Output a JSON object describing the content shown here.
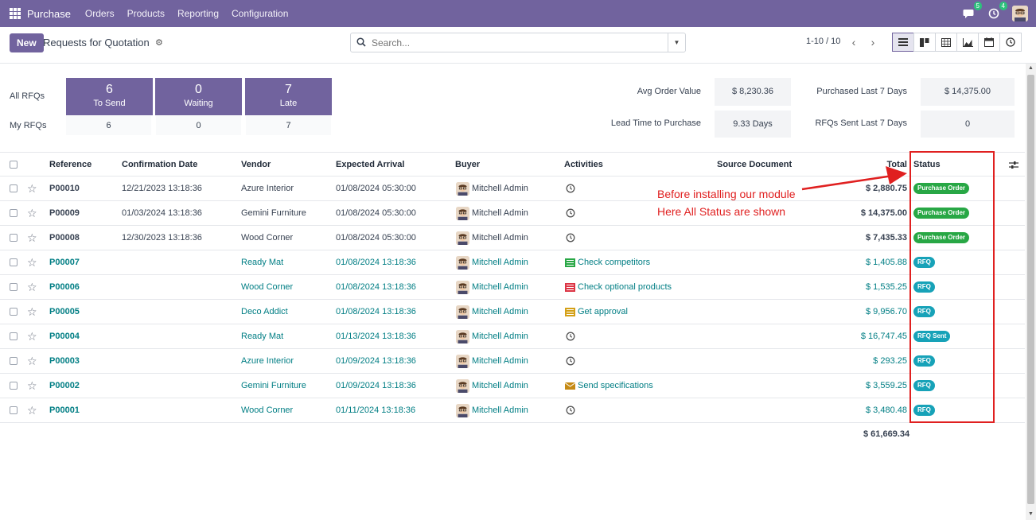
{
  "nav": {
    "brand": "Purchase",
    "menu": [
      "Orders",
      "Products",
      "Reporting",
      "Configuration"
    ],
    "messages_count": "5",
    "activities_count": "4"
  },
  "control": {
    "new_label": "New",
    "title": "Requests for Quotation",
    "search_placeholder": "Search...",
    "pager": "1-10 / 10"
  },
  "dashboard": {
    "all_rfqs_label": "All RFQs",
    "my_rfqs_label": "My RFQs",
    "tiles": [
      {
        "value": "6",
        "label": "To Send",
        "mine": "6"
      },
      {
        "value": "0",
        "label": "Waiting",
        "mine": "0"
      },
      {
        "value": "7",
        "label": "Late",
        "mine": "7"
      }
    ],
    "stats": [
      {
        "label": "Avg Order Value",
        "value": "$ 8,230.36"
      },
      {
        "label": "Purchased Last 7 Days",
        "value": "$ 14,375.00"
      },
      {
        "label": "Lead Time to Purchase",
        "value": "9.33 Days"
      },
      {
        "label": "RFQs Sent Last 7 Days",
        "value": "0"
      }
    ]
  },
  "table": {
    "columns": [
      "Reference",
      "Confirmation Date",
      "Vendor",
      "Expected Arrival",
      "Buyer",
      "Activities",
      "Source Document",
      "Total",
      "Status"
    ],
    "rows": [
      {
        "ref": "P00010",
        "conf": "12/21/2023 13:18:36",
        "vendor": "Azure Interior",
        "arrival": "01/08/2024 05:30:00",
        "buyer": "Mitchell Admin",
        "activity": "",
        "act_icon": "clock",
        "total": "$ 2,880.75",
        "status": "Purchase Order",
        "kind": "po"
      },
      {
        "ref": "P00009",
        "conf": "01/03/2024 13:18:36",
        "vendor": "Gemini Furniture",
        "arrival": "01/08/2024 05:30:00",
        "buyer": "Mitchell Admin",
        "activity": "",
        "act_icon": "clock",
        "total": "$ 14,375.00",
        "status": "Purchase Order",
        "kind": "po"
      },
      {
        "ref": "P00008",
        "conf": "12/30/2023 13:18:36",
        "vendor": "Wood Corner",
        "arrival": "01/08/2024 05:30:00",
        "buyer": "Mitchell Admin",
        "activity": "",
        "act_icon": "clock",
        "total": "$ 7,435.33",
        "status": "Purchase Order",
        "kind": "po"
      },
      {
        "ref": "P00007",
        "conf": "",
        "vendor": "Ready Mat",
        "arrival": "01/08/2024 13:18:36",
        "buyer": "Mitchell Admin",
        "activity": "Check competitors",
        "act_icon": "list-green",
        "total": "$ 1,405.88",
        "status": "RFQ",
        "kind": "rfq"
      },
      {
        "ref": "P00006",
        "conf": "",
        "vendor": "Wood Corner",
        "arrival": "01/08/2024 13:18:36",
        "buyer": "Mitchell Admin",
        "activity": "Check optional products",
        "act_icon": "list-red",
        "total": "$ 1,535.25",
        "status": "RFQ",
        "kind": "rfq"
      },
      {
        "ref": "P00005",
        "conf": "",
        "vendor": "Deco Addict",
        "arrival": "01/08/2024 13:18:36",
        "buyer": "Mitchell Admin",
        "activity": "Get approval",
        "act_icon": "list-yellow",
        "total": "$ 9,956.70",
        "status": "RFQ",
        "kind": "rfq"
      },
      {
        "ref": "P00004",
        "conf": "",
        "vendor": "Ready Mat",
        "arrival": "01/13/2024 13:18:36",
        "buyer": "Mitchell Admin",
        "activity": "",
        "act_icon": "clock",
        "total": "$ 16,747.45",
        "status": "RFQ Sent",
        "kind": "rfq"
      },
      {
        "ref": "P00003",
        "conf": "",
        "vendor": "Azure Interior",
        "arrival": "01/09/2024 13:18:36",
        "buyer": "Mitchell Admin",
        "activity": "",
        "act_icon": "clock",
        "total": "$ 293.25",
        "status": "RFQ",
        "kind": "rfq"
      },
      {
        "ref": "P00002",
        "conf": "",
        "vendor": "Gemini Furniture",
        "arrival": "01/09/2024 13:18:36",
        "buyer": "Mitchell Admin",
        "activity": "Send specifications",
        "act_icon": "envelope",
        "total": "$ 3,559.25",
        "status": "RFQ",
        "kind": "rfq"
      },
      {
        "ref": "P00001",
        "conf": "",
        "vendor": "Wood Corner",
        "arrival": "01/11/2024 13:18:36",
        "buyer": "Mitchell Admin",
        "activity": "",
        "act_icon": "clock",
        "total": "$ 3,480.48",
        "status": "RFQ",
        "kind": "rfq"
      }
    ],
    "grand_total": "$ 61,669.34"
  },
  "annotation": {
    "line1": "Before installing our module",
    "line2": "Here All Status are shown",
    "color": "#e02020"
  },
  "colors": {
    "brand": "#71639e",
    "link": "#017e84",
    "po_badge": "#28a745",
    "rfq_badge": "#17a2b8"
  }
}
